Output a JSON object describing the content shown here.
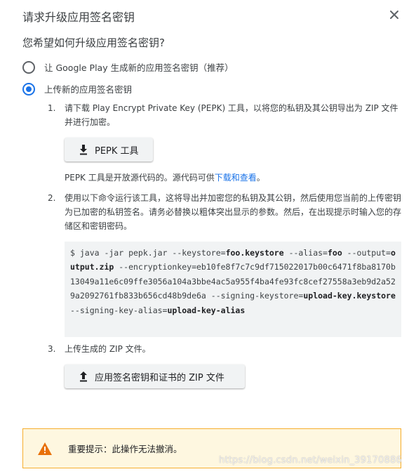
{
  "dialog": {
    "title": "请求升级应用签名密钥",
    "question": "您希望如何升级应用签名密钥?"
  },
  "options": [
    {
      "label": "让 Google Play 生成新的应用签名密钥（推荐）",
      "checked": false
    },
    {
      "label": "上传新的应用签名密钥",
      "checked": true
    }
  ],
  "steps": {
    "s1_num": "1.",
    "s1_text": "请下载 Play Encrypt Private Key (PEPK) 工具，以将您的私钥及其公钥导出为 ZIP 文件并进行加密。",
    "pepk_button": "PEPK 工具",
    "note_prefix": "PEPK 工具是开放源代码的。源代码可供",
    "note_link": "下载和查看",
    "note_suffix": "。",
    "s2_num": "2.",
    "s2_text": "使用以下命令运行该工具，这将导出并加密您的私钥及其公钥，然后使用您当前的上传密钥为已加密的私钥签名。请务必替换以粗体突出显示的参数。然后，在出现提示时输入您的存储区和密钥密码。",
    "s3_num": "3.",
    "s3_text": "上传生成的 ZIP 文件。",
    "upload_button": "应用签名密钥和证书的 ZIP 文件"
  },
  "command": {
    "p1": "$ java -jar pepk.jar --keystore=",
    "keystore": "foo.keystore",
    "p2": " --alias=",
    "alias": "foo",
    "p3": " --output=",
    "output": "output.zip",
    "p4": " --encryptionkey=eb10fe8f7c7c9df715022017b00c6471f8ba8170b13049a11e6c09ffe3056a104a3bbe4ac5a955f4ba4fe93fc8cef27558a3eb9d2a529a2092761fb833b656cd48b9de6a --signing-keystore=",
    "signing_keystore": "upload-key.keystore",
    "p5": " --signing-key-alias=",
    "signing_key_alias": "upload-key-alias"
  },
  "warning": {
    "text": "重要提示：此操作无法撤消。"
  },
  "watermark": "https://blog.csdn.net/weixin_39170886",
  "colors": {
    "accent": "#1a73e8",
    "warning_border": "#f6ae2d",
    "warning_bg": "#fef7e0",
    "warning_icon": "#e8710a",
    "code_bg": "#f1f3f4"
  },
  "icons": {
    "close": "close-icon",
    "download": "download-icon",
    "upload": "upload-icon",
    "warning": "warning-icon"
  }
}
